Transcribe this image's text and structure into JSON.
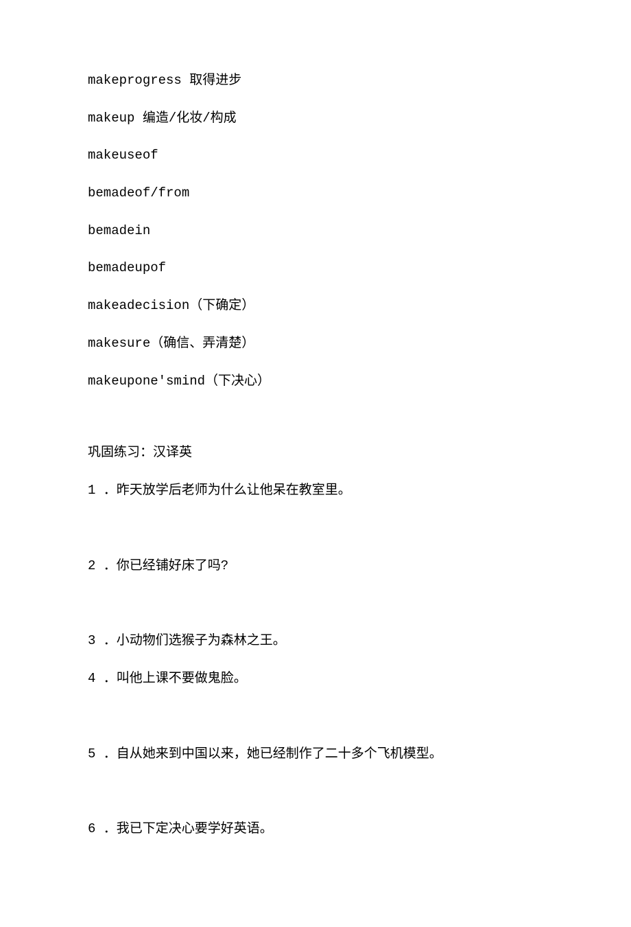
{
  "vocab": [
    "makeprogress 取得进步",
    "makeup 编造/化妆/构成",
    "makeuseof",
    "bemadeof/from",
    "bemadein",
    "bemadeupof",
    "makeadecision（下确定）",
    "makesure（确信、弄清楚）",
    "makeupone'smind（下决心）"
  ],
  "practiceHeader": "巩固练习：汉译英",
  "questions": [
    "1 ．昨天放学后老师为什么让他呆在教室里。",
    "2 ．你已经铺好床了吗?",
    "3 ．小动物们选猴子为森林之王。",
    "4 ．叫他上课不要做鬼脸。",
    "5 ．自从她来到中国以来，她已经制作了二十多个飞机模型。",
    "6 ．我已下定决心要学好英语。"
  ]
}
